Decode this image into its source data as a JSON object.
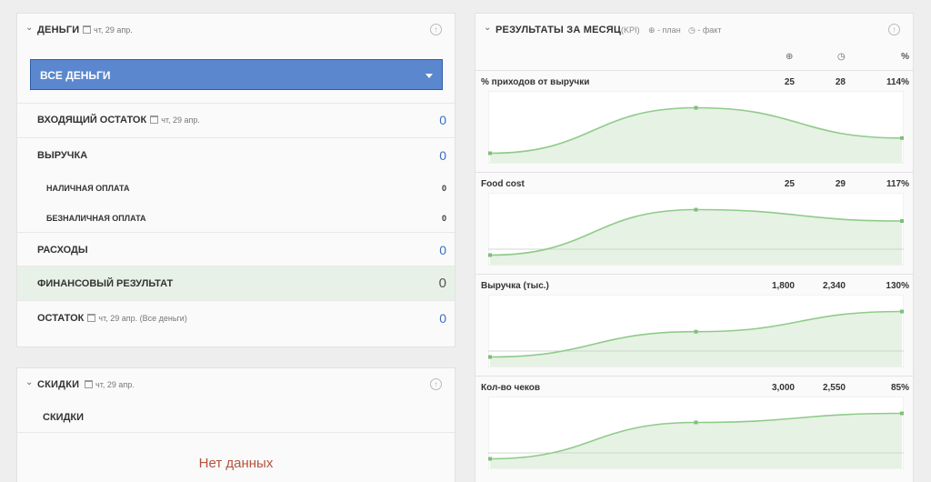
{
  "money": {
    "title": "ДЕНЬГИ",
    "date": "чт, 29 апр.",
    "select_value": "ВСЕ ДЕНЬГИ",
    "rows": [
      {
        "label": "ВХОДЯЩИЙ ОСТАТОК",
        "date": "чт, 29 апр.",
        "value": "0"
      },
      {
        "label": "ВЫРУЧКА",
        "value": "0"
      },
      {
        "label": "НАЛИЧНАЯ ОПЛАТА",
        "value": "0"
      },
      {
        "label": "БЕЗНАЛИЧНАЯ ОПЛАТА",
        "value": "0"
      },
      {
        "label": "РАСХОДЫ",
        "value": "0"
      },
      {
        "label": "ФИНАНСОВЫЙ РЕЗУЛЬТАТ",
        "value": "0"
      },
      {
        "label": "ОСТАТОК",
        "date": "чт, 29 апр. (Все деньги)",
        "value": "0"
      }
    ]
  },
  "discounts": {
    "title": "СКИДКИ",
    "date": "чт, 29 апр.",
    "subhead": "СКИДКИ",
    "empty_text": "Нет данных"
  },
  "kpi": {
    "title": "РЕЗУЛЬТАТЫ ЗА МЕСЯЦ",
    "tag": "(KPI)",
    "legend_plan": "- план",
    "legend_fact": "- факт",
    "percent_header": "%",
    "items": [
      {
        "name": "% приходов от выручки",
        "plan": "25",
        "fact": "28",
        "percent": "114%"
      },
      {
        "name": "Food cost",
        "plan": "25",
        "fact": "29",
        "percent": "117%"
      },
      {
        "name": "Выручка (тыс.)",
        "plan": "1,800",
        "fact": "2,340",
        "percent": "130%"
      },
      {
        "name": "Кол-во чеков",
        "plan": "3,000",
        "fact": "2,550",
        "percent": "85%"
      }
    ]
  },
  "colors": {
    "accent": "#5b87cf",
    "chart_line": "#8fcb8a",
    "chart_fill": "#e6f2e4",
    "highlight_row": "#e8f1e8",
    "empty_text": "#b5523d"
  },
  "chart_data": [
    {
      "type": "area",
      "title": "% приходов от выручки",
      "series": [
        {
          "values": [
            25,
            28,
            26
          ]
        }
      ]
    },
    {
      "type": "area",
      "title": "Food cost",
      "series": [
        {
          "values": [
            25,
            29,
            28
          ]
        }
      ]
    },
    {
      "type": "area",
      "title": "Выручка (тыс.)",
      "series": [
        {
          "values": [
            1800,
            2100,
            2340
          ]
        }
      ]
    },
    {
      "type": "area",
      "title": "Кол-во чеков",
      "series": [
        {
          "values": [
            2400,
            2520,
            2550
          ]
        }
      ]
    }
  ]
}
